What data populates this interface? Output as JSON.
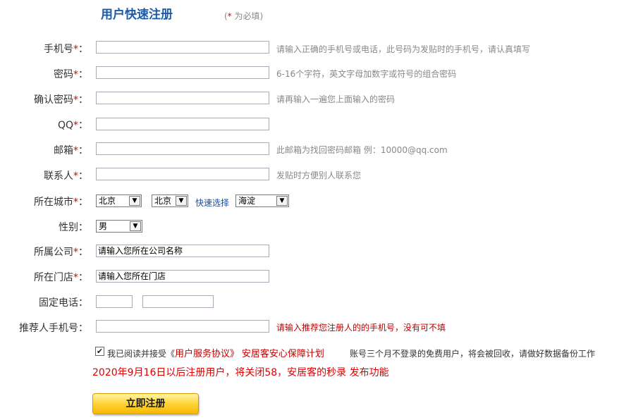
{
  "header": {
    "title": "用户快速注册",
    "required_prefix": "(",
    "required_star": "*",
    "required_text": " 为必填)"
  },
  "required_star": "*",
  "form": {
    "phone": {
      "label": "手机号",
      "hint": "请输入正确的手机号或电话，此号码为发贴时的手机号，请认真填写"
    },
    "password": {
      "label": "密码",
      "hint": "6-16个字符，英文字母加数字或符号的组合密码"
    },
    "confirm_password": {
      "label": "确认密码",
      "hint": "请再输入一遍您上面输入的密码"
    },
    "qq": {
      "label": "QQ"
    },
    "email": {
      "label": "邮箱",
      "hint": "此邮箱为找回密码邮箱 例：10000@qq.com"
    },
    "contact": {
      "label": "联系人",
      "hint": "发贴时方便别人联系您"
    },
    "city": {
      "label": "所在城市",
      "province": "北京",
      "city": "北京",
      "quick_select": "快速选择",
      "district": "海淀"
    },
    "gender": {
      "label": "性别：",
      "value": "男"
    },
    "company": {
      "label": "所属公司",
      "value": "请输入您所在公司名称"
    },
    "store": {
      "label": "所在门店",
      "value": "请输入您所在门店"
    },
    "landline": {
      "label": "固定电话："
    },
    "referrer": {
      "label": "推荐人手机号：",
      "hint": "请输入推荐您注册人的的手机号，没有可不填"
    },
    "agreement": {
      "prefix": "我已阅读并接受《",
      "terms": "用户服务协议》",
      "plan": "安居客安心保障计划",
      "checked": "✔"
    },
    "notice_gray": "账号三个月不登录的免费用户，将会被回收，请做好数据备份工作",
    "notice_red": "2020年9月16日以后注册用户，将关闭58，安居客的秒录 发布功能",
    "submit_label": "立即注册"
  },
  "icons": {
    "dropdown_arrow": "▼"
  }
}
